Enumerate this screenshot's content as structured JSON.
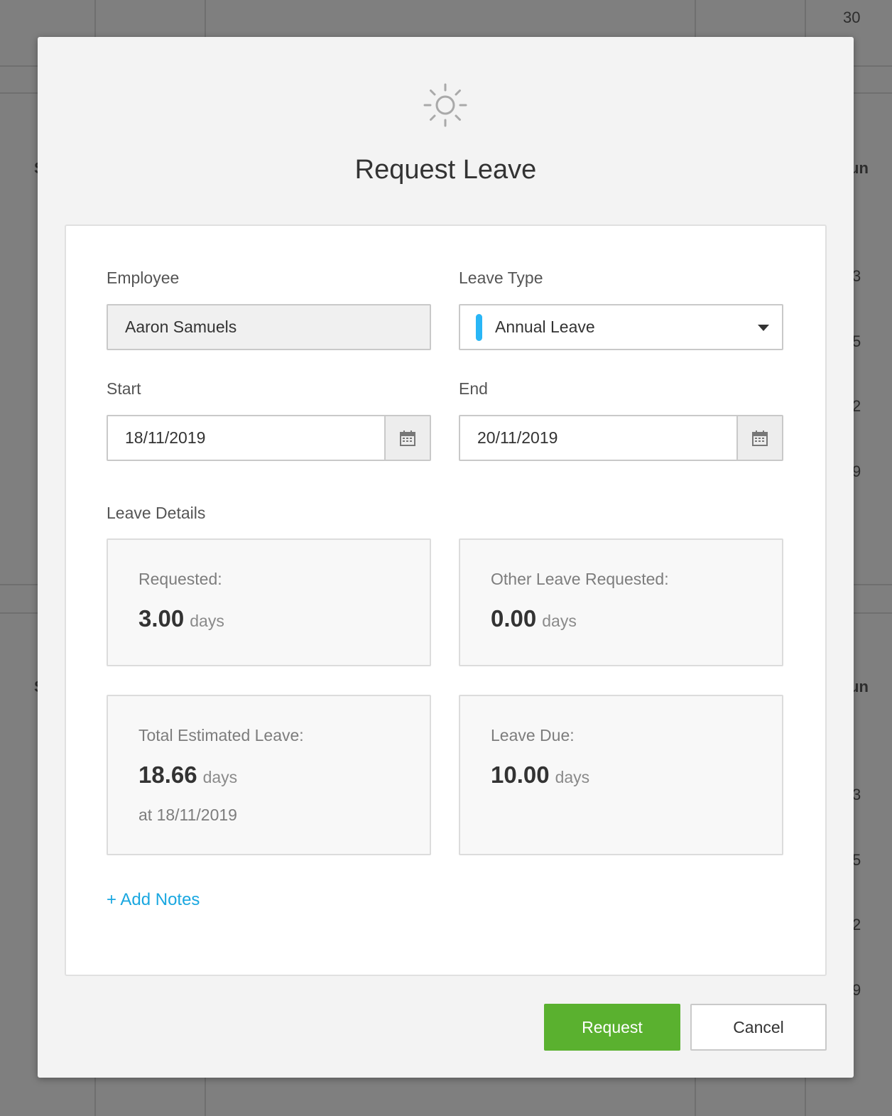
{
  "background": {
    "date_top": "30",
    "row_digits": [
      "3",
      "5",
      "2",
      "9",
      "3",
      "5",
      "2",
      "9"
    ],
    "weekday_left": "S",
    "weekday_right": "un"
  },
  "modal": {
    "icon": "sun-icon",
    "title": "Request Leave",
    "employee": {
      "label": "Employee",
      "value": "Aaron Samuels"
    },
    "leave_type": {
      "label": "Leave Type",
      "value": "Annual Leave",
      "color": "#29b6f6"
    },
    "start": {
      "label": "Start",
      "value": "18/11/2019"
    },
    "end": {
      "label": "End",
      "value": "20/11/2019"
    },
    "leave_details_label": "Leave Details",
    "cards": {
      "requested": {
        "label": "Requested:",
        "value": "3.00",
        "unit": "days"
      },
      "other": {
        "label": "Other Leave Requested:",
        "value": "0.00",
        "unit": "days"
      },
      "total": {
        "label": "Total Estimated Leave:",
        "value": "18.66",
        "unit": "days",
        "sub": "at 18/11/2019"
      },
      "due": {
        "label": "Leave Due:",
        "value": "10.00",
        "unit": "days"
      }
    },
    "add_notes": "+ Add Notes",
    "buttons": {
      "request": "Request",
      "cancel": "Cancel"
    }
  },
  "colors": {
    "primary_button": "#5ab12f",
    "link": "#1aa7e0",
    "overlay": "#7f7f7f"
  }
}
